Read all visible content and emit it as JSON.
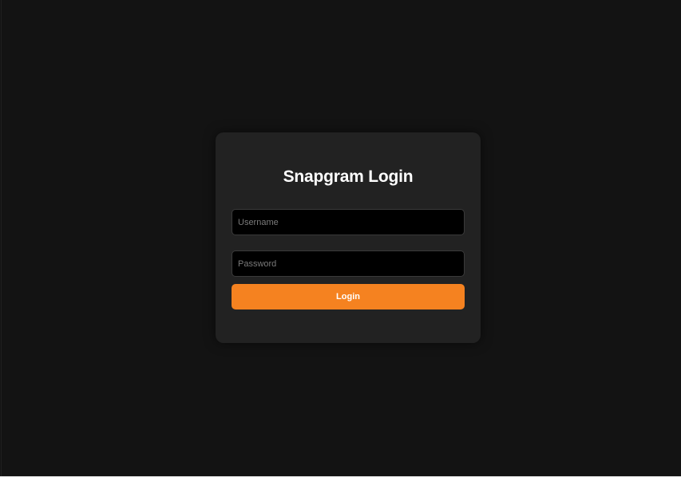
{
  "login": {
    "title": "Snapgram Login",
    "username_placeholder": "Username",
    "username_value": "",
    "password_placeholder": "Password",
    "password_value": "",
    "submit_label": "Login"
  },
  "colors": {
    "background": "#131313",
    "card": "#222222",
    "input": "#000000",
    "accent": "#f58220",
    "text": "#ffffff"
  }
}
